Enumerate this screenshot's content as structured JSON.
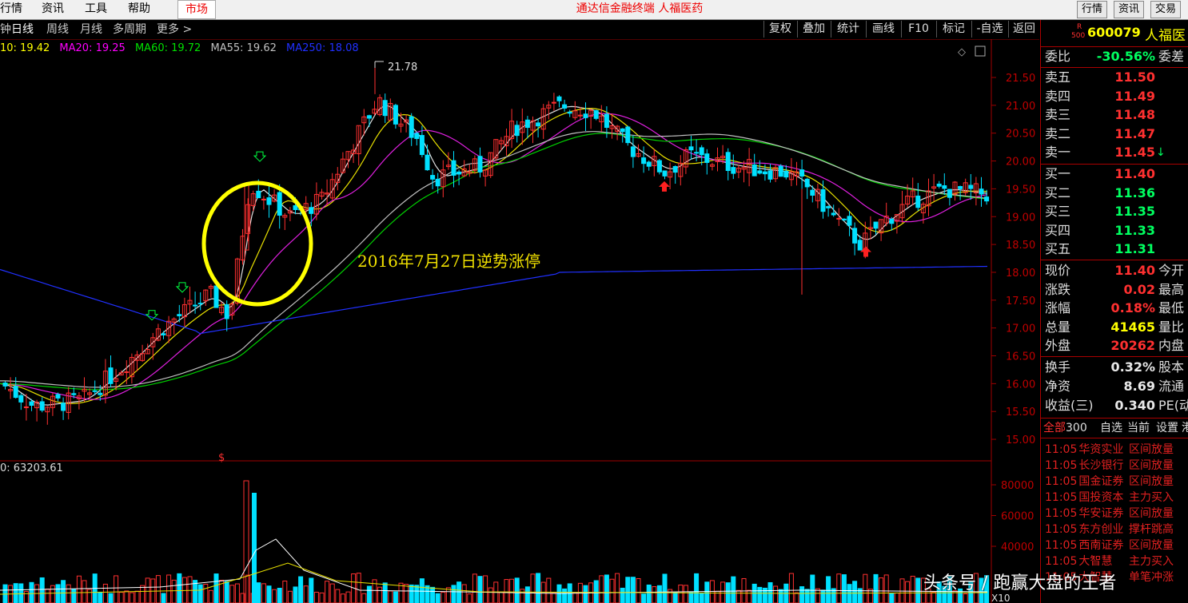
{
  "menubar": {
    "items": [
      "行情",
      "资讯",
      "工具",
      "帮助"
    ],
    "market_tab": "市场",
    "title": "通达信金融终端  人福医药",
    "right_buttons": [
      "行情",
      "资讯",
      "交易"
    ]
  },
  "toolbar": {
    "left_items": [
      "钟",
      "日线",
      "周线",
      "月线",
      "多周期",
      "更多 >"
    ],
    "right_buttons": [
      "复权",
      "叠加",
      "统计",
      "画线",
      "F10",
      "标记",
      "-自选",
      "返回"
    ]
  },
  "ma_legend": [
    {
      "text": "10: 19.42",
      "color": "#ffff00"
    },
    {
      "text": "MA20: 19.25",
      "color": "#ff00ff"
    },
    {
      "text": "MA60: 19.72",
      "color": "#00e000"
    },
    {
      "text": "MA55: 19.62",
      "color": "#c0c0c0"
    },
    {
      "text": "MA250: 18.08",
      "color": "#2030ff"
    }
  ],
  "price_axis": [
    "21.50",
    "21.00",
    "20.50",
    "20.00",
    "19.50",
    "19.00",
    "18.50",
    "18.00",
    "17.50",
    "17.00",
    "16.50",
    "16.00",
    "15.50",
    "15.00"
  ],
  "volume_axis": [
    "80000",
    "60000",
    "40000"
  ],
  "peak_label": "21.78",
  "annotation": "2016年7月27日逆势涨停",
  "volume_label": "0: 63203.61",
  "x10_label": "X10",
  "stock": {
    "badge_r": "R",
    "badge_500": "500",
    "code": "600079",
    "name": "人福医"
  },
  "order_book": {
    "weibi": {
      "label": "委比",
      "value": "-30.56%",
      "label2": "委差"
    },
    "sell": [
      {
        "label": "卖五",
        "price": "11.50"
      },
      {
        "label": "卖四",
        "price": "11.49"
      },
      {
        "label": "卖三",
        "price": "11.48"
      },
      {
        "label": "卖二",
        "price": "11.47"
      },
      {
        "label": "卖一",
        "price": "11.45",
        "arrow": "↓"
      }
    ],
    "buy": [
      {
        "label": "买一",
        "price": "11.40"
      },
      {
        "label": "买二",
        "price": "11.36"
      },
      {
        "label": "买三",
        "price": "11.35"
      },
      {
        "label": "买四",
        "price": "11.33"
      },
      {
        "label": "买五",
        "price": "11.31"
      }
    ]
  },
  "quote": [
    {
      "label": "现价",
      "value": "11.40",
      "label2": "今开",
      "color": "#ff3030"
    },
    {
      "label": "涨跌",
      "value": "0.02",
      "label2": "最高",
      "color": "#ff3030"
    },
    {
      "label": "涨幅",
      "value": "0.18%",
      "label2": "最低",
      "color": "#ff3030"
    },
    {
      "label": "总量",
      "value": "41465",
      "label2": "量比",
      "color": "#ffff00"
    },
    {
      "label": "外盘",
      "value": "20262",
      "label2": "内盘",
      "color": "#ff3030"
    }
  ],
  "stats": [
    {
      "label": "换手",
      "value": "0.32%",
      "label2": "股本"
    },
    {
      "label": "净资",
      "value": "8.69",
      "label2": "流通"
    },
    {
      "label": "收益(三)",
      "value": "0.340",
      "label2": "PE(动"
    }
  ],
  "ticker_tabs": [
    "全部",
    "300",
    "自选",
    "当前",
    "设置",
    "港"
  ],
  "ticker": [
    {
      "time": "11:05",
      "name": "华资实业",
      "event": "区间放量"
    },
    {
      "time": "11:05",
      "name": "长沙银行",
      "event": "区间放量"
    },
    {
      "time": "11:05",
      "name": "国金证券",
      "event": "区间放量"
    },
    {
      "time": "11:05",
      "name": "国投资本",
      "event": "主力买入"
    },
    {
      "time": "11:05",
      "name": "华安证券",
      "event": "区间放量"
    },
    {
      "time": "11:05",
      "name": "东方创业",
      "event": "撑杆跳高"
    },
    {
      "time": "11:05",
      "name": "西南证券",
      "event": "区间放量"
    },
    {
      "time": "11:05",
      "name": "大智慧",
      "event": "主力买入"
    },
    {
      "time": "11:05",
      "name": "大智慧",
      "event": "单笔冲涨"
    }
  ],
  "watermark": "头条号 / 跑赢大盘的王者",
  "colors": {
    "up": "#ff3030",
    "down": "#00e0ff",
    "ma_white": "#e0e0e0",
    "ma_yellow": "#e8e000",
    "ma_magenta": "#e020e0",
    "ma_green": "#00d000",
    "ma_blue": "#2030ff",
    "circle": "#ffff00"
  }
}
